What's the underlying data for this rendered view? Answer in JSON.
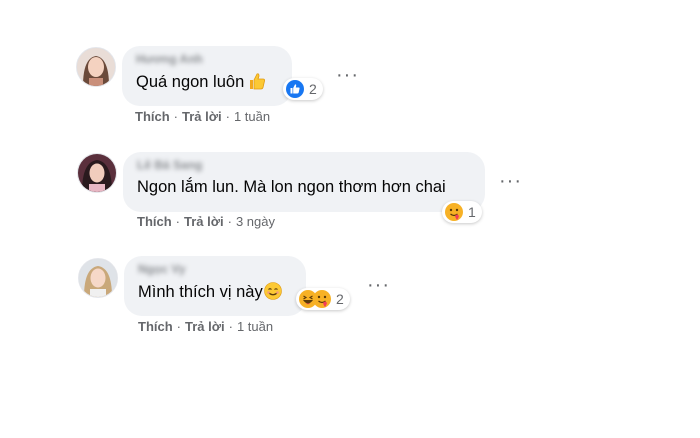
{
  "comments": [
    {
      "name": "Hương Anh",
      "text": "Quá ngon luôn",
      "emoji": "thumbs-up-emoji",
      "reaction_icons": [
        "like-icon"
      ],
      "reaction_count": "2",
      "like_label": "Thích",
      "reply_label": "Trả lời",
      "separator": "·",
      "time": "1 tuần"
    },
    {
      "name": "Lê Bá Sang",
      "text": "Ngon lắm lun. Mà lon ngon thơm hơn chai",
      "emoji": "",
      "reaction_icons": [
        "love-react-icon"
      ],
      "reaction_count": "1",
      "like_label": "Thích",
      "reply_label": "Trả lời",
      "separator": "·",
      "time": "3 ngày"
    },
    {
      "name": "Ngọc Vy",
      "text": "Mình thích vị này",
      "emoji": "smiling-face-emoji",
      "reaction_icons": [
        "haha-react-icon",
        "love-react-icon"
      ],
      "reaction_count": "2",
      "like_label": "Thích",
      "reply_label": "Trả lời",
      "separator": "·",
      "time": "1 tuần"
    }
  ],
  "colors": {
    "bubble": "#f0f2f5",
    "meta": "#65676b",
    "like_blue": "#1877f2"
  }
}
